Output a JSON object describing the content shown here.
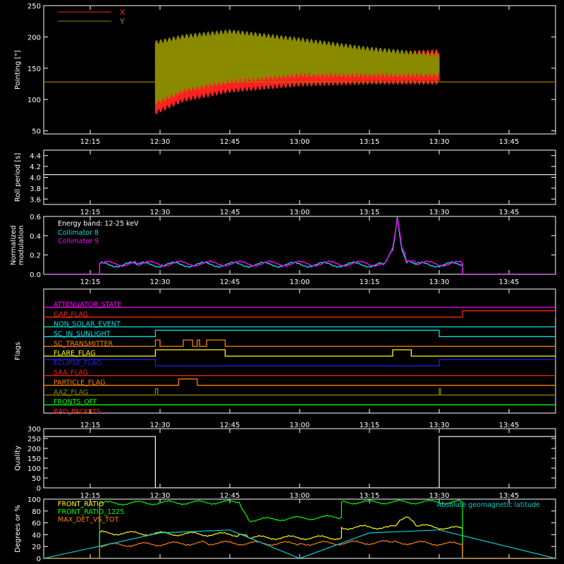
{
  "x_ticks": [
    "12:15",
    "12:30",
    "12:45",
    "13:00",
    "13:15",
    "13:30",
    "13:45"
  ],
  "chart_data": [
    {
      "type": "area",
      "ylabel": "Pointing [\"]",
      "xlim": [
        "12:05",
        "13:55"
      ],
      "ylim": [
        45,
        250
      ],
      "yticks": [
        50,
        100,
        150,
        200,
        250
      ],
      "legend_placement": "top-left",
      "series": [
        {
          "name": "X",
          "color": "#ff2020",
          "baseline": 128,
          "start": "12:29",
          "end": "13:30",
          "band": [
            [
              "12:29",
              80,
              165
            ],
            [
              "12:35",
              100,
              155
            ],
            [
              "12:45",
              115,
              155
            ],
            [
              "13:00",
              125,
              165
            ],
            [
              "13:15",
              128,
              172
            ],
            [
              "13:30",
              128,
              176
            ]
          ]
        },
        {
          "name": "Y",
          "color": "#8a8a00",
          "baseline": 128,
          "start": "12:29",
          "end": "13:30",
          "band": [
            [
              "12:29",
              95,
              190
            ],
            [
              "12:35",
              115,
              200
            ],
            [
              "12:45",
              130,
              208
            ],
            [
              "13:00",
              140,
              195
            ],
            [
              "13:15",
              140,
              180
            ],
            [
              "13:30",
              140,
              170
            ]
          ]
        }
      ]
    },
    {
      "type": "line",
      "ylabel": "Roll period [s]",
      "xlim": [
        "12:05",
        "13:55"
      ],
      "ylim": [
        3.5,
        4.5
      ],
      "yticks": [
        3.6,
        3.8,
        4.0,
        4.2,
        4.4
      ],
      "series": [
        {
          "name": "",
          "color": "#ffffff",
          "x": [
            "12:05",
            "13:55"
          ],
          "values": [
            4.05,
            4.05
          ]
        }
      ]
    },
    {
      "type": "line",
      "ylabel": "Normalized modulation",
      "annotation": "Energy band: 12-25 keV",
      "xlim": [
        "12:05",
        "13:55"
      ],
      "ylim": [
        0,
        0.6
      ],
      "yticks": [
        0.0,
        0.2,
        0.4,
        0.6
      ],
      "series": [
        {
          "name": "Collimator 8",
          "color": "#00e0e0",
          "x": [
            "12:05",
            "12:17",
            "12:17",
            "12:25",
            "13:18",
            "13:20",
            "13:21",
            "13:22",
            "13:23",
            "13:25",
            "13:35",
            "13:35",
            "13:55"
          ],
          "values": [
            0,
            0,
            0.1,
            0.1,
            0.1,
            0.25,
            0.6,
            0.25,
            0.12,
            0.1,
            0.1,
            0,
            0
          ]
        },
        {
          "name": "Collimator 9",
          "color": "#ff00ff",
          "x": [
            "12:05",
            "12:17",
            "12:17",
            "12:25",
            "13:18",
            "13:20",
            "13:21",
            "13:22",
            "13:23",
            "13:25",
            "13:35",
            "13:35",
            "13:55"
          ],
          "values": [
            0,
            0,
            0.11,
            0.11,
            0.11,
            0.28,
            0.58,
            0.27,
            0.13,
            0.11,
            0.11,
            0,
            0
          ]
        }
      ]
    },
    {
      "type": "line",
      "ylabel": "Flags",
      "xlim": [
        "12:05",
        "13:55"
      ],
      "flags": [
        {
          "name": "ATTENUATOR_STATE",
          "color": "#ff00ff",
          "segments": []
        },
        {
          "name": "GAP_FLAG",
          "color": "#ff2020",
          "segments": [
            [
              "13:35",
              "13:55"
            ]
          ]
        },
        {
          "name": "NON_SOLAR_EVENT",
          "color": "#00e0e0",
          "segments": []
        },
        {
          "name": "SC_IN_SUNLIGHT",
          "color": "#00e0e0",
          "segments": [
            [
              "12:29",
              "13:30"
            ]
          ]
        },
        {
          "name": "SC_TRANSMITTER",
          "color": "#ff8000",
          "segments": [
            [
              "12:29",
              "12:30"
            ],
            [
              "12:35",
              "12:37"
            ],
            [
              "12:38",
              "12:38.5"
            ],
            [
              "12:40",
              "12:44"
            ]
          ]
        },
        {
          "name": "FLARE_FLAG",
          "color": "#ffff00",
          "segments": [
            [
              "12:29",
              "12:44"
            ],
            [
              "13:20",
              "13:24"
            ]
          ]
        },
        {
          "name": "ECLIPSE_FLAG",
          "color": "#2020ff",
          "inverted": true,
          "segments": [
            [
              "12:29",
              "13:30"
            ]
          ]
        },
        {
          "name": "SAA_FLAG",
          "color": "#ff2020",
          "segments": []
        },
        {
          "name": "PARTICLE_FLAG",
          "color": "#ff8000",
          "segments": [
            [
              "12:34",
              "12:38"
            ]
          ]
        },
        {
          "name": "AAZ_FLAG",
          "color": "#8a8a00",
          "segments": [
            [
              "12:29",
              "12:29.5"
            ],
            [
              "13:30",
              "13:30.3"
            ]
          ]
        },
        {
          "name": "FRONTS_OFF",
          "color": "#00ff00",
          "segments": []
        },
        {
          "name": "BAD_PACKETS",
          "color": "#ff2020",
          "segments": []
        }
      ]
    },
    {
      "type": "line",
      "ylabel": "Quality",
      "xlim": [
        "12:05",
        "13:55"
      ],
      "ylim": [
        0,
        300
      ],
      "yticks": [
        0,
        50,
        100,
        150,
        200,
        250,
        300
      ],
      "series": [
        {
          "name": "",
          "color": "#ffffff",
          "x": [
            "12:05",
            "12:29",
            "12:29",
            "13:30",
            "13:30",
            "13:55"
          ],
          "values": [
            260,
            260,
            0,
            0,
            260,
            260
          ]
        }
      ]
    },
    {
      "type": "line",
      "ylabel": "Degrees or %",
      "annotation": "Absolute geomagnetic latitude",
      "xlim": [
        "12:05",
        "13:55"
      ],
      "ylim": [
        0,
        100
      ],
      "yticks": [
        0,
        20,
        40,
        60,
        80,
        100
      ],
      "series": [
        {
          "name": "FRONT_RATIO",
          "color": "#ffff00",
          "x": [
            "12:05",
            "12:17",
            "12:17",
            "12:47",
            "12:49",
            "13:09",
            "13:09",
            "13:19",
            "13:21",
            "13:23",
            "13:25",
            "13:35",
            "13:35",
            "13:55"
          ],
          "values": [
            0,
            0,
            43,
            40,
            35,
            35,
            52,
            53,
            58,
            70,
            55,
            50,
            0,
            0
          ]
        },
        {
          "name": "FRONT_RATIO_1225",
          "color": "#00ff00",
          "x": [
            "12:05",
            "12:17",
            "12:17",
            "12:47",
            "12:49",
            "13:09",
            "13:09",
            "13:35",
            "13:35",
            "13:55"
          ],
          "values": [
            0,
            0,
            93,
            95,
            65,
            70,
            95,
            95,
            0,
            0
          ]
        },
        {
          "name": "MAX_DET_VS_TOT",
          "color": "#ff8000",
          "x": [
            "12:05",
            "12:17",
            "12:17",
            "12:40",
            "13:00",
            "13:20",
            "13:35",
            "13:35",
            "13:55"
          ],
          "values": [
            0,
            0,
            22,
            26,
            25,
            27,
            24,
            0,
            0
          ]
        },
        {
          "name": "Absolute geomagnetic latitude",
          "color": "#00d0d0",
          "x": [
            "12:05",
            "12:30",
            "12:45",
            "13:00",
            "13:15",
            "13:30",
            "13:55"
          ],
          "values": [
            0,
            43,
            48,
            0,
            43,
            48,
            0
          ]
        }
      ]
    }
  ]
}
